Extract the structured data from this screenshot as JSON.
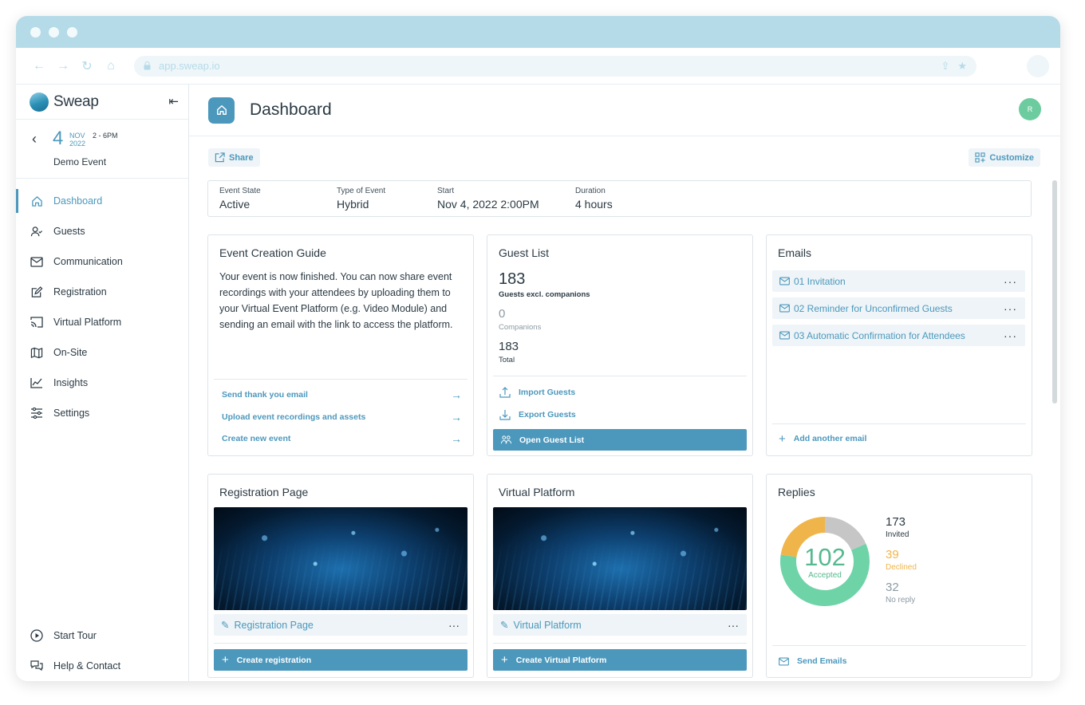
{
  "browser": {
    "url": "app.sweap.io"
  },
  "brand": {
    "name": "Sweap"
  },
  "event": {
    "day": "4",
    "month": "NOV",
    "year": "2022",
    "hours": "2 - 6PM",
    "name": "Demo Event"
  },
  "nav": {
    "items": [
      {
        "label": "Dashboard",
        "icon": "home-icon",
        "active": true
      },
      {
        "label": "Guests",
        "icon": "guests-icon"
      },
      {
        "label": "Communication",
        "icon": "mail-icon"
      },
      {
        "label": "Registration",
        "icon": "edit-form-icon"
      },
      {
        "label": "Virtual Platform",
        "icon": "cast-icon"
      },
      {
        "label": "On-Site",
        "icon": "map-icon"
      },
      {
        "label": "Insights",
        "icon": "chart-icon"
      },
      {
        "label": "Settings",
        "icon": "sliders-icon"
      }
    ],
    "bottom": [
      {
        "label": "Start Tour",
        "icon": "play-icon"
      },
      {
        "label": "Help & Contact",
        "icon": "chat-icon"
      }
    ]
  },
  "header": {
    "title": "Dashboard",
    "avatar": "R"
  },
  "toolbar": {
    "share": "Share",
    "customize": "Customize"
  },
  "state": {
    "event_state_label": "Event State",
    "event_state": "Active",
    "type_label": "Type of Event",
    "type": "Hybrid",
    "start_label": "Start",
    "start": "Nov 4, 2022 2:00PM",
    "duration_label": "Duration",
    "duration": "4 hours"
  },
  "guide": {
    "title": "Event Creation Guide",
    "text": "Your event is now finished. You can now share event recordings with your attendees by uploading them to your Virtual Event Platform (e.g. Video Module) and sending an email with the link to access the platform.",
    "links": [
      "Send thank you email",
      "Upload event recordings and assets",
      "Create new event"
    ]
  },
  "guest_list": {
    "title": "Guest List",
    "guests": "183",
    "guests_label": "Guests excl. companions",
    "companions": "0",
    "companions_label": "Companions",
    "total": "183",
    "total_label": "Total",
    "import": "Import Guests",
    "export": "Export Guests",
    "open": "Open Guest List"
  },
  "emails": {
    "title": "Emails",
    "items": [
      "01 Invitation",
      "02 Reminder for Unconfirmed Guests",
      "03 Automatic Confirmation for Attendees"
    ],
    "more": "···",
    "add": "Add another email"
  },
  "registration": {
    "title": "Registration Page",
    "page": "Registration Page",
    "more": "···",
    "create": "Create registration"
  },
  "virtual": {
    "title": "Virtual Platform",
    "page": "Virtual Platform",
    "more": "···",
    "create": "Create Virtual Platform"
  },
  "replies": {
    "title": "Replies",
    "accepted": "102",
    "accepted_label": "Accepted",
    "invited": "173",
    "invited_label": "Invited",
    "declined": "39",
    "declined_label": "Declined",
    "no_reply": "32",
    "no_reply_label": "No reply",
    "send": "Send Emails",
    "colors": {
      "accepted": "#6fd3a8",
      "declined": "#f0b54a",
      "no_reply": "#c6c6c6"
    }
  },
  "colors": {
    "accent": "#4c98bd",
    "chrome": "#b5dbe8"
  }
}
